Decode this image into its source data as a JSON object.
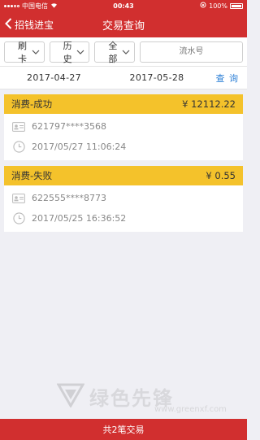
{
  "status_bar": {
    "carrier": "中国电信",
    "time": "00:43",
    "battery": "100%"
  },
  "nav": {
    "back_label": "招钱进宝",
    "title": "交易查询"
  },
  "filters": {
    "type_select": "刷卡",
    "period_select": "历史",
    "status_select": "全部",
    "serial_placeholder": "流水号"
  },
  "date_range": {
    "start": "2017-04-27",
    "end": "2017-05-28",
    "query_label": "查 询"
  },
  "transactions": [
    {
      "title": "消费-成功",
      "amount": "¥ 12112.22",
      "card": "621797****3568",
      "time": "2017/05/27 11:06:24"
    },
    {
      "title": "消费-失败",
      "amount": "¥ 0.55",
      "card": "622555****8773",
      "time": "2017/05/25 16:36:52"
    }
  ],
  "footer": {
    "summary": "共2笔交易"
  },
  "watermark": {
    "text": "绿色先锋",
    "url": "www.greenxf.com"
  },
  "colors": {
    "brand_red": "#d12f2f",
    "card_header": "#f4c22b",
    "link_blue": "#2c7fd6"
  }
}
